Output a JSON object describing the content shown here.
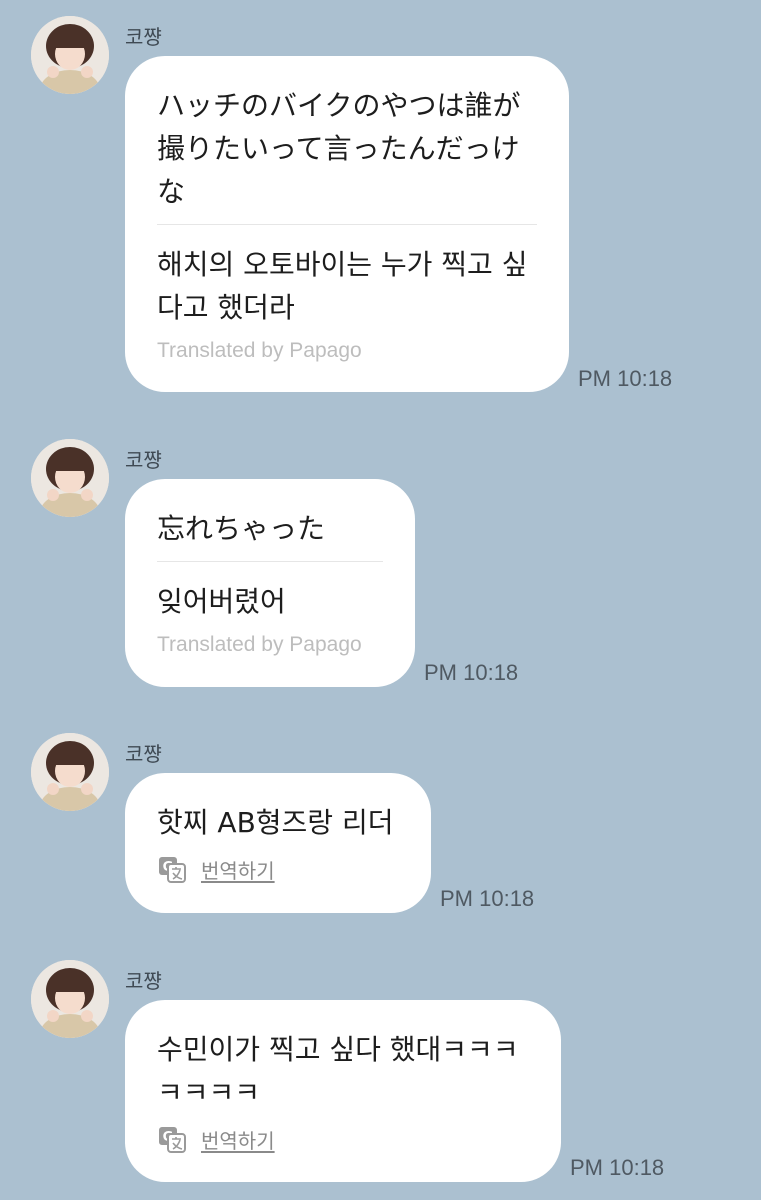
{
  "colors": {
    "background": "#abc0d0",
    "bubble": "#ffffff",
    "credit": "#bdbdbd"
  },
  "messages": [
    {
      "sender": "코쨩",
      "original": "ハッチのバイクのやつは誰が\n撮りたいって言ったんだっけ\nな",
      "translation": "해치의 오토바이는 누가 찍고 싶\n다고 했더라",
      "credit": "Translated by Papago",
      "time": "PM 10:18"
    },
    {
      "sender": "코쨩",
      "original": "忘れちゃった",
      "translation": "잊어버렸어",
      "credit": "Translated by Papago",
      "time": "PM 10:18"
    },
    {
      "sender": "코쨩",
      "text": "핫찌 AB형즈랑 리더",
      "translate_label": "번역하기",
      "translate_icon": "translate-icon",
      "time": "PM 10:18"
    },
    {
      "sender": "코쨩",
      "text": "수민이가 찍고 싶다 했대ㅋㅋㅋ\nㅋㅋㅋㅋ",
      "translate_label": "번역하기",
      "translate_icon": "translate-icon",
      "time": "PM 10:18"
    }
  ]
}
